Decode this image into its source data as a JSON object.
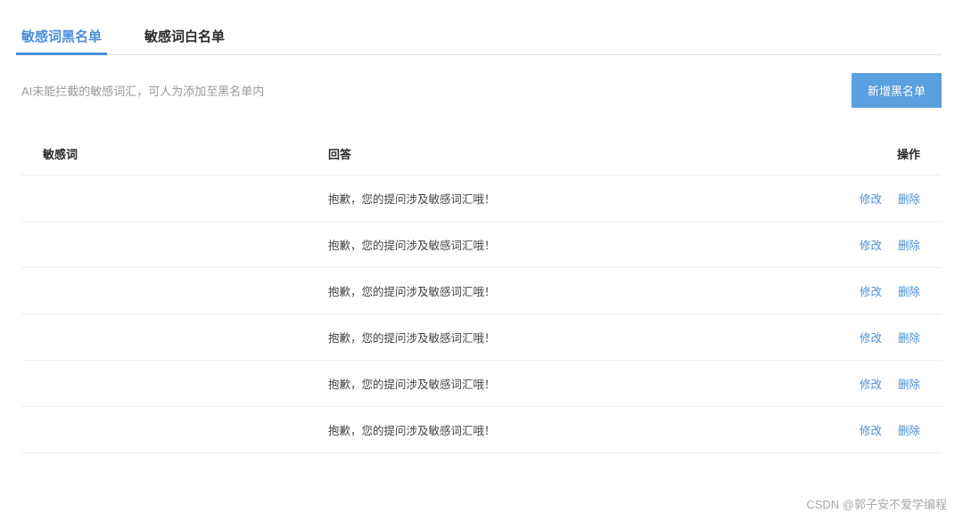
{
  "tabs": {
    "blacklist": "敏感词黑名单",
    "whitelist": "敏感词白名单"
  },
  "description": "AI未能拦截的敏感词汇，可人为添加至黑名单内",
  "addButton": "新增黑名单",
  "columns": {
    "word": "敏感词",
    "answer": "回答",
    "actions": "操作"
  },
  "actions": {
    "edit": "修改",
    "delete": "删除"
  },
  "rows": [
    {
      "word": "",
      "answer": "抱歉，您的提问涉及敏感词汇哦！"
    },
    {
      "word": "",
      "answer": "抱歉，您的提问涉及敏感词汇哦！"
    },
    {
      "word": "",
      "answer": "抱歉，您的提问涉及敏感词汇哦！"
    },
    {
      "word": "",
      "answer": "抱歉，您的提问涉及敏感词汇哦！"
    },
    {
      "word": "",
      "answer": "抱歉，您的提问涉及敏感词汇哦！"
    },
    {
      "word": "",
      "answer": "抱歉，您的提问涉及敏感词汇哦！"
    }
  ],
  "watermark": "CSDN @郭子安不爱学编程"
}
